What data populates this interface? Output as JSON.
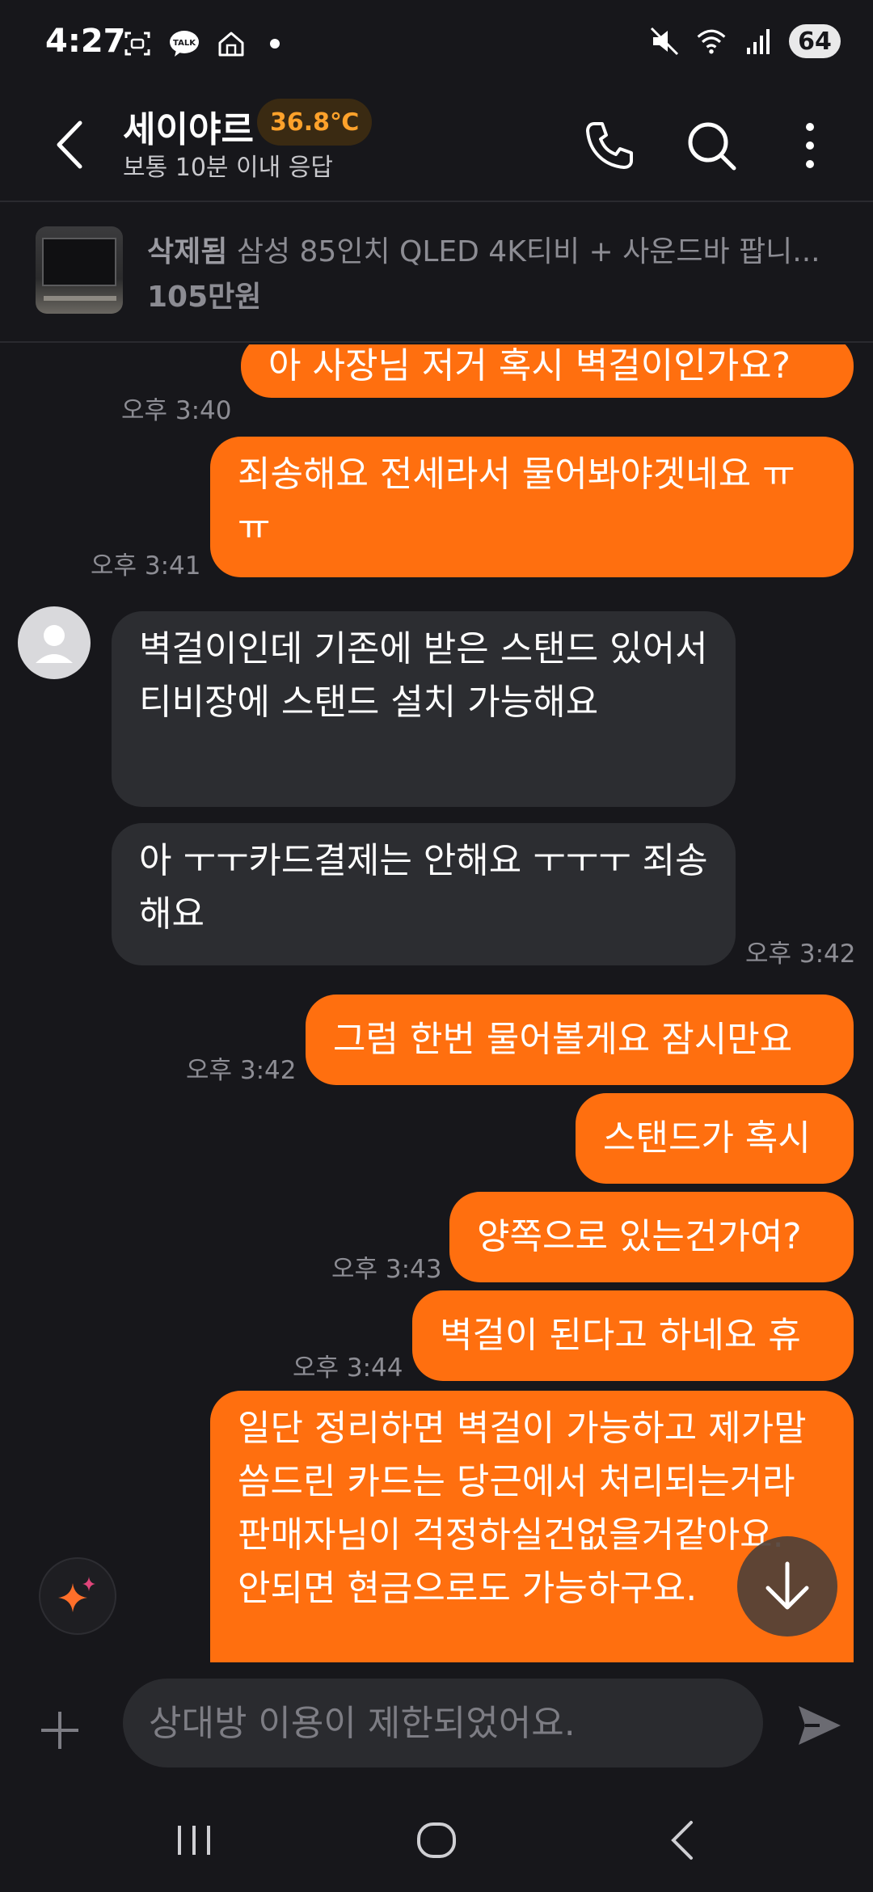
{
  "status_bar": {
    "time": "4:27",
    "battery": "64",
    "left_icons": [
      "screenshot-icon",
      "talk-icon",
      "home-icon"
    ],
    "right_icons": [
      "mute-icon",
      "wifi-icon",
      "signal-icon"
    ]
  },
  "header": {
    "title": "세이야르",
    "temperature": "36.8℃",
    "subtitle": "보통 10분 이내 응답"
  },
  "product": {
    "deleted_label": "삭제됨",
    "name": "삼성 85인치 QLED 4K티비 + 사운드바 팝니...",
    "price": "105만원"
  },
  "messages": [
    {
      "from": "me",
      "text": "아 사장님 저거 혹시 벽걸이인가요?",
      "time": "오후 3:40"
    },
    {
      "from": "me",
      "text": "죄송해요 전세라서 물어봐야겟네요 ㅠㅠ",
      "time": "오후 3:41"
    },
    {
      "from": "them",
      "text": "벽걸이인데 기존에 받은 스탠드 있어서 티비장에 스탠드 설치 가능해요",
      "time": ""
    },
    {
      "from": "them",
      "text": "아 ㅜㅜ카드결제는 안해요 ㅜㅜㅜ 죄송해요",
      "time": "오후 3:42"
    },
    {
      "from": "me",
      "text": "그럼 한번 물어볼게요 잠시만요",
      "time": "오후 3:42"
    },
    {
      "from": "me",
      "text": "스탠드가 혹시",
      "time": ""
    },
    {
      "from": "me",
      "text": "양쪽으로 있는건가여?",
      "time": "오후 3:43"
    },
    {
      "from": "me",
      "text": "벽걸이 된다고 하네요 휴",
      "time": "오후 3:44"
    },
    {
      "from": "me",
      "text": "일단 정리하면 벽걸이 가능하고 제가말씀드린 카드는 당근에서 처리되는거라 판매자님이 걱정하실건없을거같아요. 안되면 현금으로도 가능하구요.",
      "time": ""
    }
  ],
  "composer": {
    "placeholder": "상대방 이용이 제한되었어요."
  },
  "colors": {
    "background": "#17171b",
    "my_bubble": "#ff6f0f",
    "their_bubble": "#2c2d31",
    "temperature": "#ffa22b"
  }
}
